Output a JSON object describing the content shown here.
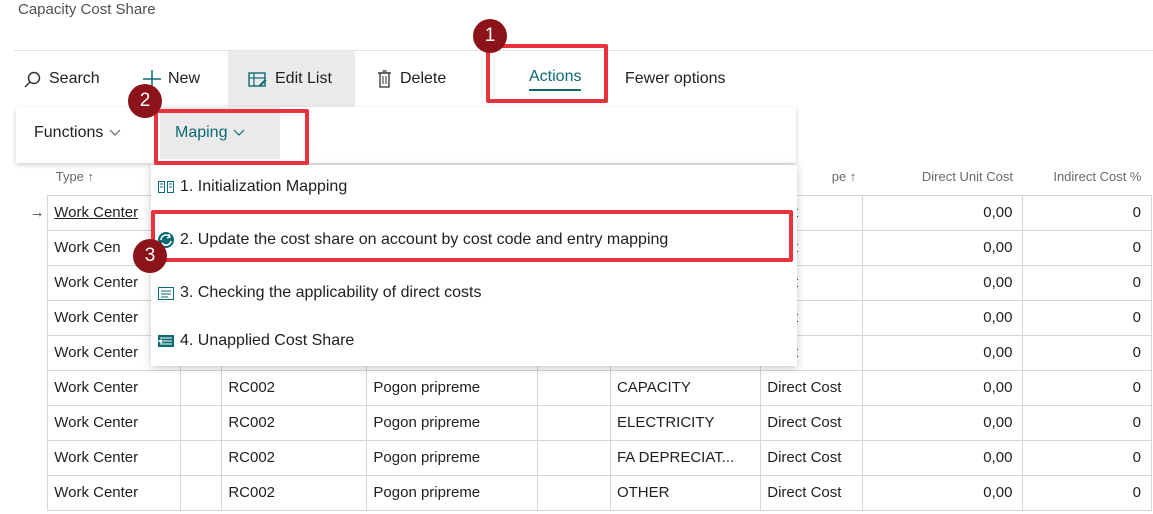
{
  "page": {
    "title": "Capacity Cost Share"
  },
  "action_bar": {
    "search": "Search",
    "new": "New",
    "edit_list": "Edit List",
    "delete": "Delete",
    "actions": "Actions",
    "fewer_options": "Fewer options"
  },
  "sub_menu": {
    "functions": "Functions",
    "maping": "Maping"
  },
  "dropdown": {
    "items": [
      {
        "label": "1. Initialization Mapping",
        "icon": "mapping-icon"
      },
      {
        "label": "2. Update the cost share on account by cost code and entry mapping",
        "icon": "update-icon"
      },
      {
        "label": "3. Checking the applicability of direct costs",
        "icon": "checklist-icon"
      },
      {
        "label": "4. Unapplied Cost Share",
        "icon": "unapplied-icon"
      }
    ]
  },
  "table": {
    "headers": {
      "type": "Type ↑",
      "entry_type": "pe ↑",
      "direct_unit_cost": "Direct Unit Cost",
      "indirect_cost_pct": "Indirect Cost %"
    },
    "rows": [
      {
        "type": "Work Center",
        "no": "",
        "name": "",
        "cost_code": "",
        "entry_type": "Cost",
        "direct_unit_cost": "0,00",
        "indirect_cost_pct": "0"
      },
      {
        "type": "Work Cen",
        "no": "",
        "name": "",
        "cost_code": "",
        "entry_type": "Cost",
        "direct_unit_cost": "0,00",
        "indirect_cost_pct": "0"
      },
      {
        "type": "Work Center",
        "no": "",
        "name": "",
        "cost_code": "",
        "entry_type": "Cost",
        "direct_unit_cost": "0,00",
        "indirect_cost_pct": "0"
      },
      {
        "type": "Work Center",
        "no": "",
        "name": "",
        "cost_code": "",
        "entry_type": "Cost",
        "direct_unit_cost": "0,00",
        "indirect_cost_pct": "0"
      },
      {
        "type": "Work Center",
        "no": "",
        "name": "",
        "cost_code": "",
        "entry_type": "Cost",
        "direct_unit_cost": "0,00",
        "indirect_cost_pct": "0"
      },
      {
        "type": "Work Center",
        "no": "RC002",
        "name": "Pogon pripreme",
        "cost_code": "CAPACITY",
        "entry_type": "Direct Cost",
        "direct_unit_cost": "0,00",
        "indirect_cost_pct": "0"
      },
      {
        "type": "Work Center",
        "no": "RC002",
        "name": "Pogon pripreme",
        "cost_code": "ELECTRICITY",
        "entry_type": "Direct Cost",
        "direct_unit_cost": "0,00",
        "indirect_cost_pct": "0"
      },
      {
        "type": "Work Center",
        "no": "RC002",
        "name": "Pogon pripreme",
        "cost_code": "FA DEPRECIAT...",
        "entry_type": "Direct Cost",
        "direct_unit_cost": "0,00",
        "indirect_cost_pct": "0"
      },
      {
        "type": "Work Center",
        "no": "RC002",
        "name": "Pogon pripreme",
        "cost_code": "OTHER",
        "entry_type": "Direct Cost",
        "direct_unit_cost": "0,00",
        "indirect_cost_pct": "0"
      }
    ]
  },
  "annotations": {
    "badge_1": "1",
    "badge_2": "2",
    "badge_3": "3"
  },
  "colors": {
    "accent": "#0b6a74",
    "highlight": "#e8323c",
    "badge": "#8b1319"
  }
}
